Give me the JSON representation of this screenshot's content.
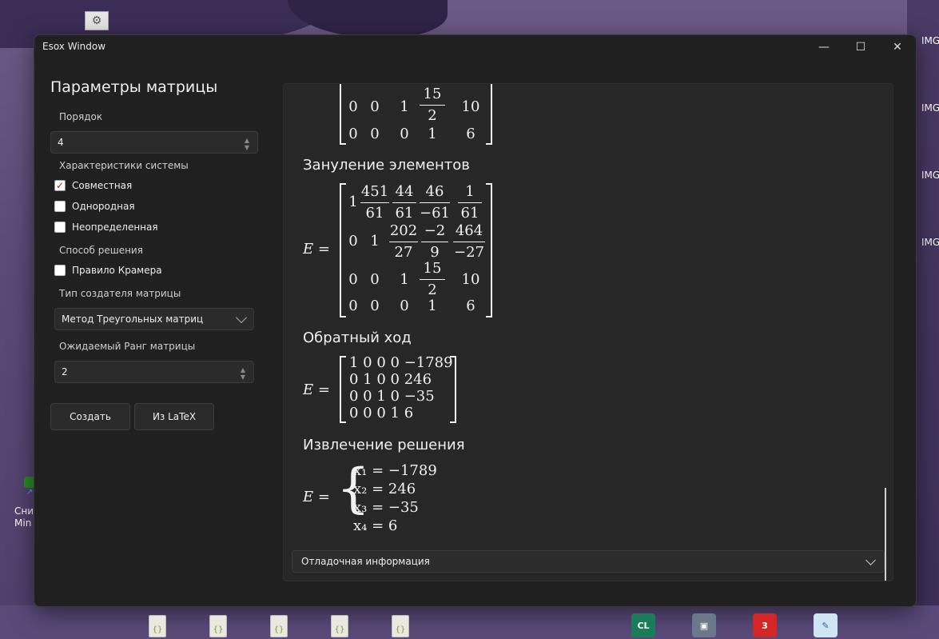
{
  "window": {
    "title": "Esox Window"
  },
  "titlebar_buttons": {
    "minimize": "—",
    "maximize": "☐",
    "close": "✕"
  },
  "left": {
    "title": "Параметры матрицы",
    "order_label": "Порядок",
    "order_value": "4",
    "system_label": "Характеристики системы",
    "checks": [
      {
        "label": "Совместная",
        "checked": true
      },
      {
        "label": "Однородная",
        "checked": false
      },
      {
        "label": "Неопределенная",
        "checked": false
      }
    ],
    "method_label": "Способ решения",
    "cramer": {
      "label": "Правило Крамера",
      "checked": false
    },
    "creator_label": "Тип создателя матрицы",
    "creator_value": "Метод Треугольных матриц",
    "rank_label": "Ожидаемый Ранг матрицы",
    "rank_value": "2",
    "create_button": "Создать",
    "latex_button": "Из LaTeX"
  },
  "content": {
    "top_matrix_rows": [
      [
        "0",
        "0",
        "1",
        "15/2",
        "10"
      ],
      [
        "0",
        "0",
        "0",
        "1",
        "6"
      ]
    ],
    "section1": "Зануление элементов",
    "section2": "Обратный ход",
    "section3": "Извлечение решения",
    "eq_label": "E =",
    "m1": {
      "r1": [
        "1",
        "451/61",
        "44/61",
        "46/−61",
        "1/61"
      ],
      "r2": [
        "0",
        "1",
        "202/27",
        "−2/9",
        "464/−27"
      ],
      "r3": [
        "0",
        "0",
        "1",
        "15/2",
        "10"
      ],
      "r4": [
        "0",
        "0",
        "0",
        "1",
        "6"
      ]
    },
    "m2": [
      "1 0 0 0 −1789",
      "0 1 0 0 246",
      "0 0 1 0 −35",
      "0 0 0 1 6"
    ],
    "solutions": [
      "x₁ = −1789",
      "x₂ = 246",
      "x₃ = −35",
      "x₄ = 6"
    ],
    "debug": "Отладочная информация"
  },
  "desktop": {
    "right_labels": [
      "IMG",
      "IMG",
      "IMG",
      "IMG"
    ],
    "left_labels": [
      "Сни",
      "Min"
    ]
  }
}
